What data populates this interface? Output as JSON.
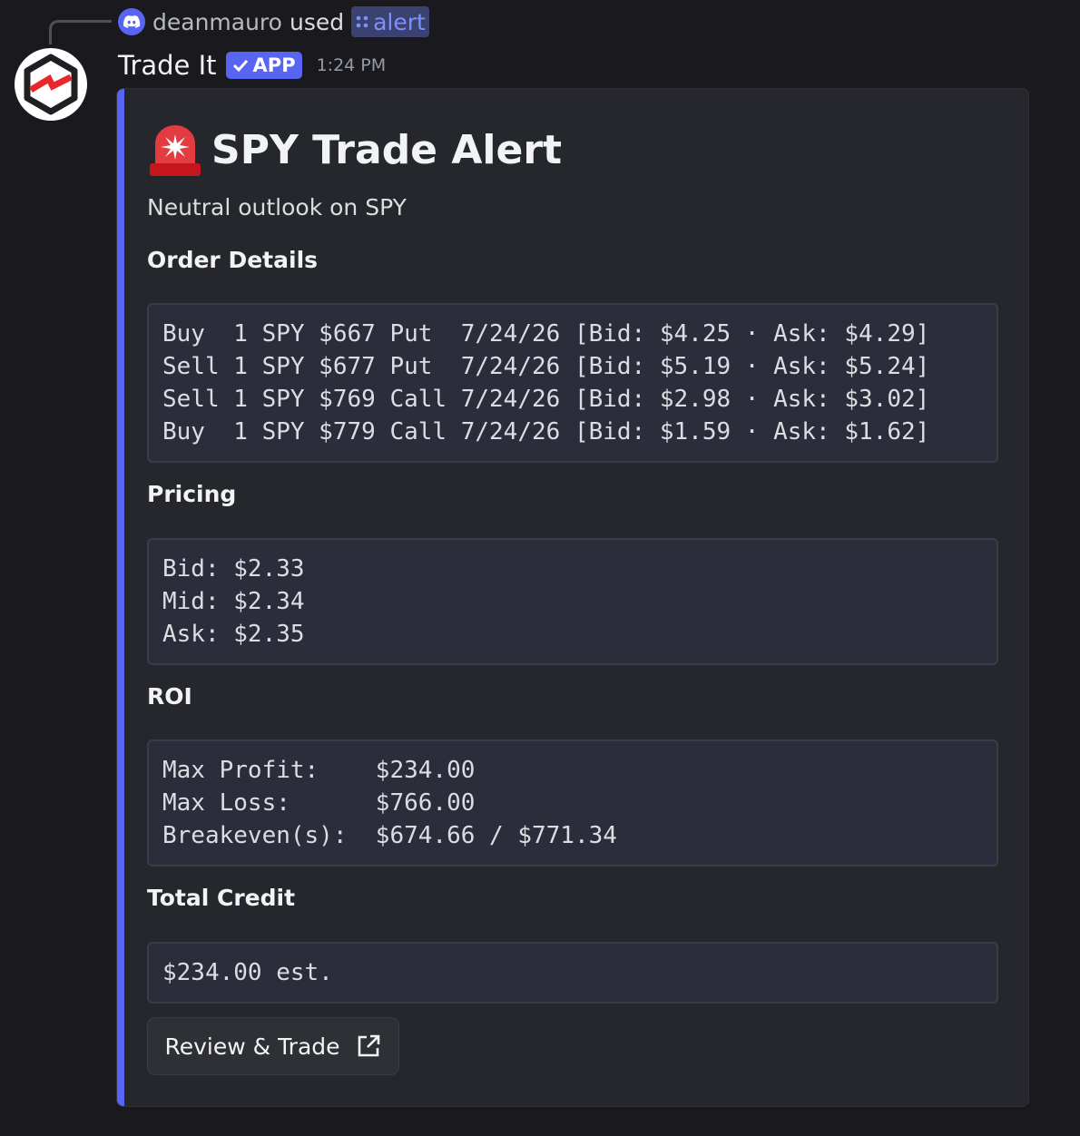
{
  "reply": {
    "username": "deanmauro",
    "action": "used",
    "command": "alert"
  },
  "message": {
    "app_name": "Trade It",
    "badge": "APP",
    "timestamp": "1:24 PM"
  },
  "embed": {
    "title": "SPY Trade Alert",
    "description": "Neutral outlook on SPY",
    "accent_color": "#5865f2",
    "fields": {
      "order_details": {
        "name": "Order Details",
        "lines": [
          "Buy  1 SPY $667 Put  7/24/26 [Bid: $4.25 · Ask: $4.29]",
          "Sell 1 SPY $677 Put  7/24/26 [Bid: $5.19 · Ask: $5.24]",
          "Sell 1 SPY $769 Call 7/24/26 [Bid: $2.98 · Ask: $3.02]",
          "Buy  1 SPY $779 Call 7/24/26 [Bid: $1.59 · Ask: $1.62]"
        ]
      },
      "pricing": {
        "name": "Pricing",
        "lines": [
          "Bid: $2.33",
          "Mid: $2.34",
          "Ask: $2.35"
        ]
      },
      "roi": {
        "name": "ROI",
        "lines": [
          "Max Profit:    $234.00",
          "Max Loss:      $766.00",
          "Breakeven(s):  $674.66 / $771.34"
        ]
      },
      "total_credit": {
        "name": "Total Credit",
        "lines": [
          "$234.00 est."
        ]
      }
    },
    "button_label": "Review & Trade"
  }
}
